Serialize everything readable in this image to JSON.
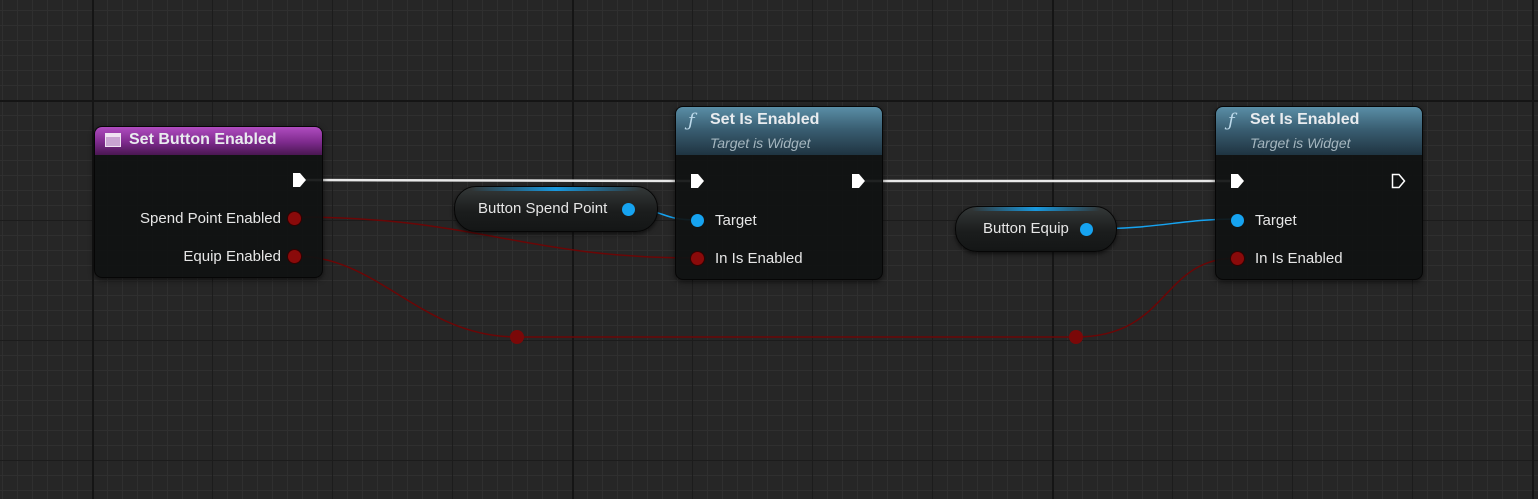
{
  "event_node": {
    "title": "Set Button Enabled",
    "icon": "event-icon",
    "pins": [
      "Spend Point Enabled",
      "Equip Enabled"
    ],
    "accent": "#7d2a8c"
  },
  "variables": {
    "spend_point": "Button Spend Point",
    "equip": "Button Equip"
  },
  "function_nodes": [
    {
      "icon_glyph": "ƒ",
      "title": "Set Is Enabled",
      "subtitle": "Target is Widget",
      "target_label": "Target",
      "enabled_label": "In Is Enabled"
    },
    {
      "icon_glyph": "ƒ",
      "title": "Set Is Enabled",
      "subtitle": "Target is Widget",
      "target_label": "Target",
      "enabled_label": "In Is Enabled"
    }
  ],
  "colors": {
    "exec_wire": "#ffffff",
    "object_wire": "#16a3f0",
    "bool_wire": "#6b0606",
    "function_header": "#3a5f73"
  }
}
